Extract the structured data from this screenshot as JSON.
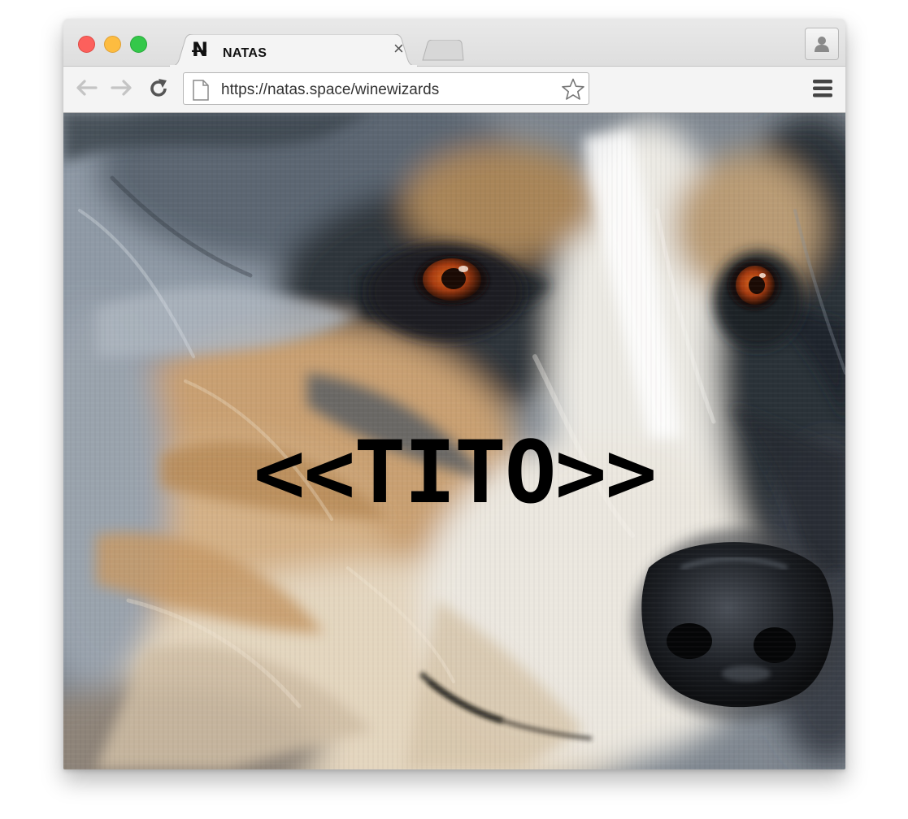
{
  "window": {
    "controls": [
      "close",
      "minimize",
      "maximize"
    ]
  },
  "tab": {
    "favicon": "N̶",
    "title": "NATAS",
    "close_glyph": "×"
  },
  "toolbar": {
    "back_icon": "arrow-left-icon",
    "forward_icon": "arrow-right-icon",
    "reload_icon": "reload-icon",
    "url": "https://natas.space/winewizards",
    "bookmark_icon": "star-icon",
    "menu_icon": "hamburger-menu-icon",
    "profile_icon": "user-icon"
  },
  "page": {
    "background_image": "painting of a dog's face (Australian Shepherd) with amber eyes and black nose",
    "overlay_text": "<<TITO>>"
  },
  "colors": {
    "close": "#fc605c",
    "minimize": "#fdbc40",
    "maximize": "#34c84a",
    "overlay_text": "#000000"
  }
}
